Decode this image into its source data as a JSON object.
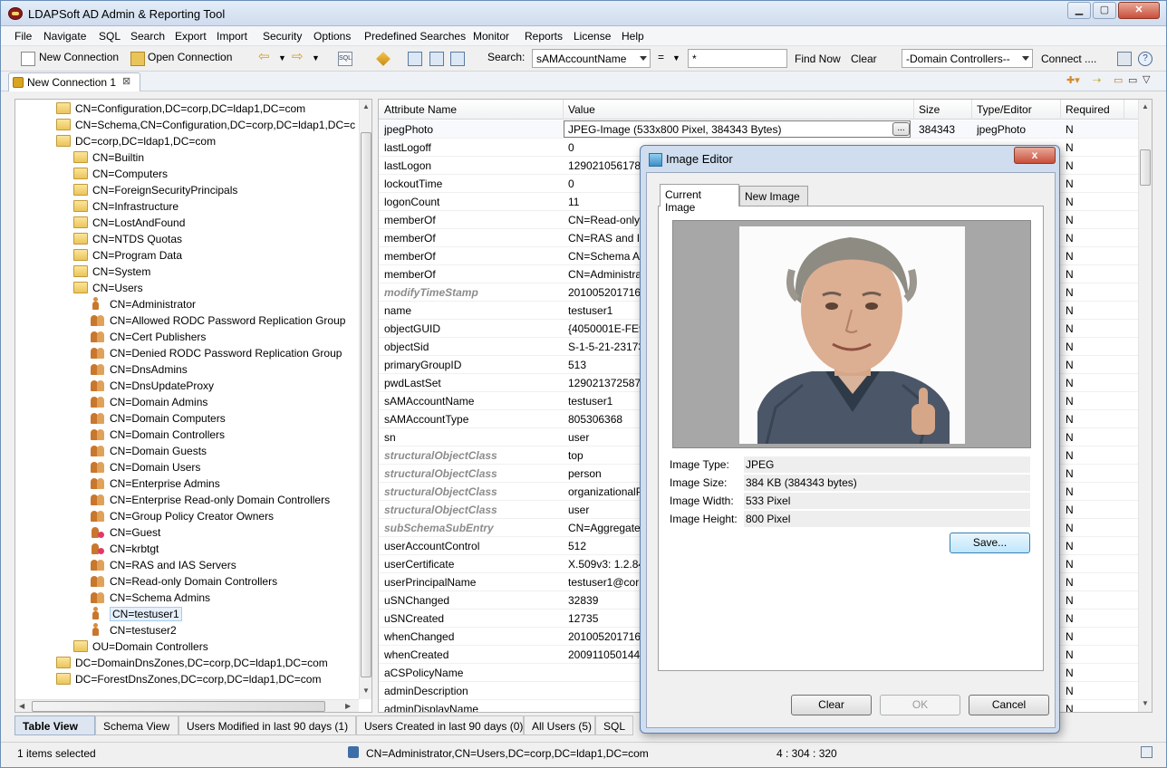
{
  "app": {
    "title": "LDAPSoft AD Admin & Reporting Tool"
  },
  "menu": [
    "File",
    "Navigate",
    "SQL",
    "Search",
    "Export",
    "Import",
    "Security",
    "Options",
    "Predefined Searches",
    "Monitor",
    "Reports",
    "License",
    "Help"
  ],
  "toolbar": {
    "new_connection": "New Connection",
    "open_connection": "Open Connection",
    "search_label": "Search:",
    "search_attr": "sAMAccountName",
    "operator": "=",
    "search_value": "*",
    "find_now": "Find Now",
    "clear": "Clear",
    "dc_filter": "-Domain Controllers--",
    "connect": "Connect ...."
  },
  "doc_tab": {
    "label": "New Connection 1",
    "close": "⊠"
  },
  "tree": [
    {
      "label": "CN=Configuration,DC=corp,DC=ldap1,DC=com",
      "icon": "folder",
      "indent": 0
    },
    {
      "label": "CN=Schema,CN=Configuration,DC=corp,DC=ldap1,DC=c",
      "icon": "folder",
      "indent": 0
    },
    {
      "label": "DC=corp,DC=ldap1,DC=com",
      "icon": "folder-open",
      "indent": 0
    },
    {
      "label": "CN=Builtin",
      "icon": "folder",
      "indent": 1
    },
    {
      "label": "CN=Computers",
      "icon": "folder",
      "indent": 1
    },
    {
      "label": "CN=ForeignSecurityPrincipals",
      "icon": "folder",
      "indent": 1
    },
    {
      "label": "CN=Infrastructure",
      "icon": "folder",
      "indent": 1
    },
    {
      "label": "CN=LostAndFound",
      "icon": "folder",
      "indent": 1
    },
    {
      "label": "CN=NTDS Quotas",
      "icon": "folder",
      "indent": 1
    },
    {
      "label": "CN=Program Data",
      "icon": "folder",
      "indent": 1
    },
    {
      "label": "CN=System",
      "icon": "folder",
      "indent": 1
    },
    {
      "label": "CN=Users",
      "icon": "folder-open",
      "indent": 1
    },
    {
      "label": "CN=Administrator",
      "icon": "user",
      "indent": 2
    },
    {
      "label": "CN=Allowed RODC Password Replication Group",
      "icon": "group",
      "indent": 2
    },
    {
      "label": "CN=Cert Publishers",
      "icon": "group",
      "indent": 2
    },
    {
      "label": "CN=Denied RODC Password Replication Group",
      "icon": "group",
      "indent": 2
    },
    {
      "label": "CN=DnsAdmins",
      "icon": "group",
      "indent": 2
    },
    {
      "label": "CN=DnsUpdateProxy",
      "icon": "group",
      "indent": 2
    },
    {
      "label": "CN=Domain Admins",
      "icon": "group",
      "indent": 2
    },
    {
      "label": "CN=Domain Computers",
      "icon": "group",
      "indent": 2
    },
    {
      "label": "CN=Domain Controllers",
      "icon": "group",
      "indent": 2
    },
    {
      "label": "CN=Domain Guests",
      "icon": "group",
      "indent": 2
    },
    {
      "label": "CN=Domain Users",
      "icon": "group",
      "indent": 2
    },
    {
      "label": "CN=Enterprise Admins",
      "icon": "group",
      "indent": 2
    },
    {
      "label": "CN=Enterprise Read-only Domain Controllers",
      "icon": "group",
      "indent": 2
    },
    {
      "label": "CN=Group Policy Creator Owners",
      "icon": "group",
      "indent": 2
    },
    {
      "label": "CN=Guest",
      "icon": "disabled-user",
      "indent": 2
    },
    {
      "label": "CN=krbtgt",
      "icon": "disabled-user",
      "indent": 2
    },
    {
      "label": "CN=RAS and IAS Servers",
      "icon": "group",
      "indent": 2
    },
    {
      "label": "CN=Read-only Domain Controllers",
      "icon": "group",
      "indent": 2
    },
    {
      "label": "CN=Schema Admins",
      "icon": "group",
      "indent": 2
    },
    {
      "label": "CN=testuser1",
      "icon": "user",
      "indent": 2,
      "selected": true
    },
    {
      "label": "CN=testuser2",
      "icon": "user",
      "indent": 2
    },
    {
      "label": "OU=Domain Controllers",
      "icon": "folder",
      "indent": 1
    },
    {
      "label": "DC=DomainDnsZones,DC=corp,DC=ldap1,DC=com",
      "icon": "folder",
      "indent": 0
    },
    {
      "label": "DC=ForestDnsZones,DC=corp,DC=ldap1,DC=com",
      "icon": "folder",
      "indent": 0
    }
  ],
  "table": {
    "headers": [
      "Attribute Name",
      "Value",
      "Size",
      "Type/Editor",
      "Required"
    ],
    "rows": [
      {
        "attr": "jpegPhoto",
        "value": "JPEG-Image (533x800 Pixel, 384343 Bytes)",
        "size": "384343",
        "type": "jpegPhoto",
        "req": "N",
        "op": false,
        "edit": true
      },
      {
        "attr": "lastLogoff",
        "value": "0",
        "size": "",
        "type": "",
        "req": "N",
        "op": false
      },
      {
        "attr": "lastLogon",
        "value": "129021056178044",
        "size": "",
        "type": "",
        "req": "N",
        "op": false
      },
      {
        "attr": "lockoutTime",
        "value": "0",
        "size": "",
        "type": "",
        "req": "N",
        "op": false
      },
      {
        "attr": "logonCount",
        "value": "11",
        "size": "",
        "type": "",
        "req": "N",
        "op": false
      },
      {
        "attr": "memberOf",
        "value": "CN=Read-only",
        "size": "",
        "type": "",
        "req": "N",
        "op": false
      },
      {
        "attr": "memberOf",
        "value": "CN=RAS and IA",
        "size": "",
        "type": "",
        "req": "N",
        "op": false
      },
      {
        "attr": "memberOf",
        "value": "CN=Schema A",
        "size": "",
        "type": "",
        "req": "N",
        "op": false
      },
      {
        "attr": "memberOf",
        "value": "CN=Administra",
        "size": "",
        "type": "",
        "req": "N",
        "op": false
      },
      {
        "attr": "modifyTimeStamp",
        "value": "20100520171634",
        "size": "",
        "type": "",
        "req": "N",
        "op": true
      },
      {
        "attr": "name",
        "value": "testuser1",
        "size": "",
        "type": "",
        "req": "N",
        "op": false
      },
      {
        "attr": "objectGUID",
        "value": "{4050001E-FE92",
        "size": "",
        "type": "",
        "req": "N",
        "op": false
      },
      {
        "attr": "objectSid",
        "value": "S-1-5-21-23173",
        "size": "",
        "type": "",
        "req": "N",
        "op": false
      },
      {
        "attr": "primaryGroupID",
        "value": "513",
        "size": "",
        "type": "",
        "req": "N",
        "op": false
      },
      {
        "attr": "pwdLastSet",
        "value": "129021372587300",
        "size": "",
        "type": "",
        "req": "N",
        "op": false
      },
      {
        "attr": "sAMAccountName",
        "value": "testuser1",
        "size": "",
        "type": "",
        "req": "N",
        "op": false
      },
      {
        "attr": "sAMAccountType",
        "value": "805306368",
        "size": "",
        "type": "",
        "req": "N",
        "op": false
      },
      {
        "attr": "sn",
        "value": "user",
        "size": "",
        "type": "",
        "req": "N",
        "op": false
      },
      {
        "attr": "structuralObjectClass",
        "value": "top",
        "size": "",
        "type": "",
        "req": "N",
        "op": true
      },
      {
        "attr": "structuralObjectClass",
        "value": "person",
        "size": "",
        "type": "",
        "req": "N",
        "op": true
      },
      {
        "attr": "structuralObjectClass",
        "value": "organizationalP",
        "size": "",
        "type": "",
        "req": "N",
        "op": true
      },
      {
        "attr": "structuralObjectClass",
        "value": "user",
        "size": "",
        "type": "",
        "req": "N",
        "op": true
      },
      {
        "attr": "subSchemaSubEntry",
        "value": "CN=Aggregate",
        "size": "",
        "type": "",
        "req": "N",
        "op": true
      },
      {
        "attr": "userAccountControl",
        "value": "512",
        "size": "",
        "type": "",
        "req": "N",
        "op": false
      },
      {
        "attr": "userCertificate",
        "value": "X.509v3: 1.2.840",
        "size": "",
        "type": "",
        "req": "N",
        "op": false
      },
      {
        "attr": "userPrincipalName",
        "value": "testuser1@corp",
        "size": "",
        "type": "",
        "req": "N",
        "op": false
      },
      {
        "attr": "uSNChanged",
        "value": "32839",
        "size": "",
        "type": "",
        "req": "N",
        "op": false
      },
      {
        "attr": "uSNCreated",
        "value": "12735",
        "size": "",
        "type": "",
        "req": "N",
        "op": false
      },
      {
        "attr": "whenChanged",
        "value": "20100520171634",
        "size": "",
        "type": "",
        "req": "N",
        "op": false
      },
      {
        "attr": "whenCreated",
        "value": "20091105014455",
        "size": "",
        "type": "",
        "req": "N",
        "op": false
      },
      {
        "attr": "aCSPolicyName",
        "value": "",
        "size": "",
        "type": "",
        "req": "N",
        "op": false
      },
      {
        "attr": "adminDescription",
        "value": "",
        "size": "",
        "type": "",
        "req": "N",
        "op": false
      },
      {
        "attr": "adminDisplayName",
        "value": "",
        "size": "",
        "type": "",
        "req": "N",
        "op": false
      }
    ],
    "edit_button": "..."
  },
  "bottom_tabs": [
    "Table View",
    "Schema View",
    "Users Modified in last 90 days (1)",
    "Users Created in last 90 days (0)",
    "All Users (5)",
    "SQL"
  ],
  "status": {
    "selected": "1 items selected",
    "dn": "CN=Administrator,CN=Users,DC=corp,DC=ldap1,DC=com",
    "position": "4 : 304 : 320"
  },
  "dialog": {
    "title": "Image Editor",
    "close": "x",
    "tabs": [
      "Current Image",
      "New Image"
    ],
    "info": [
      {
        "k": "Image Type:",
        "v": "JPEG"
      },
      {
        "k": "Image Size:",
        "v": "384 KB (384343 bytes)"
      },
      {
        "k": "Image Width:",
        "v": "533 Pixel"
      },
      {
        "k": "Image Height:",
        "v": "800 Pixel"
      }
    ],
    "save": "Save...",
    "clear": "Clear",
    "ok": "OK",
    "cancel": "Cancel"
  }
}
